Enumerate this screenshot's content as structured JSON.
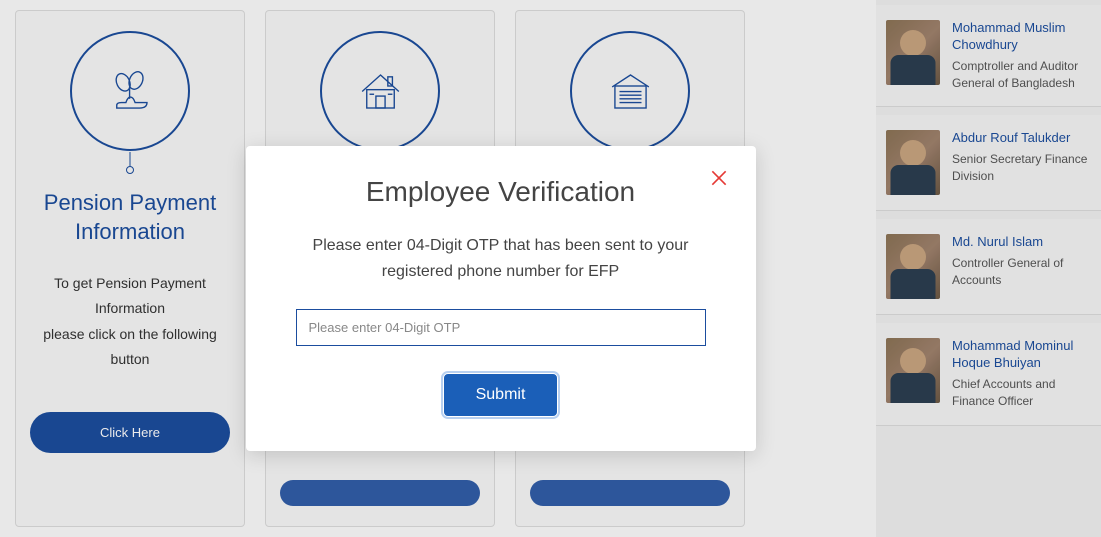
{
  "cards": [
    {
      "title": "Pension Payment Information",
      "description": "To get Pension Payment Information\nplease click on the following button",
      "button": "Click Here"
    },
    {
      "title": "",
      "description": "",
      "button": ""
    },
    {
      "title": "",
      "description": "",
      "button": ""
    }
  ],
  "sidebar": {
    "people": [
      {
        "name": "Mohammad Muslim Chowdhury",
        "title": "Comptroller and Auditor General of Bangladesh"
      },
      {
        "name": "Abdur Rouf Talukder",
        "title": "Senior Secretary Finance Division"
      },
      {
        "name": "Md. Nurul Islam",
        "title": "Controller General of Accounts"
      },
      {
        "name": "Mohammad Mominul Hoque Bhuiyan",
        "title": "Chief Accounts and Finance Officer"
      }
    ]
  },
  "modal": {
    "title": "Employee Verification",
    "text": "Please enter 04-Digit OTP that has been sent to your registered phone number for EFP",
    "placeholder": "Please enter 04-Digit OTP",
    "submit": "Submit"
  }
}
